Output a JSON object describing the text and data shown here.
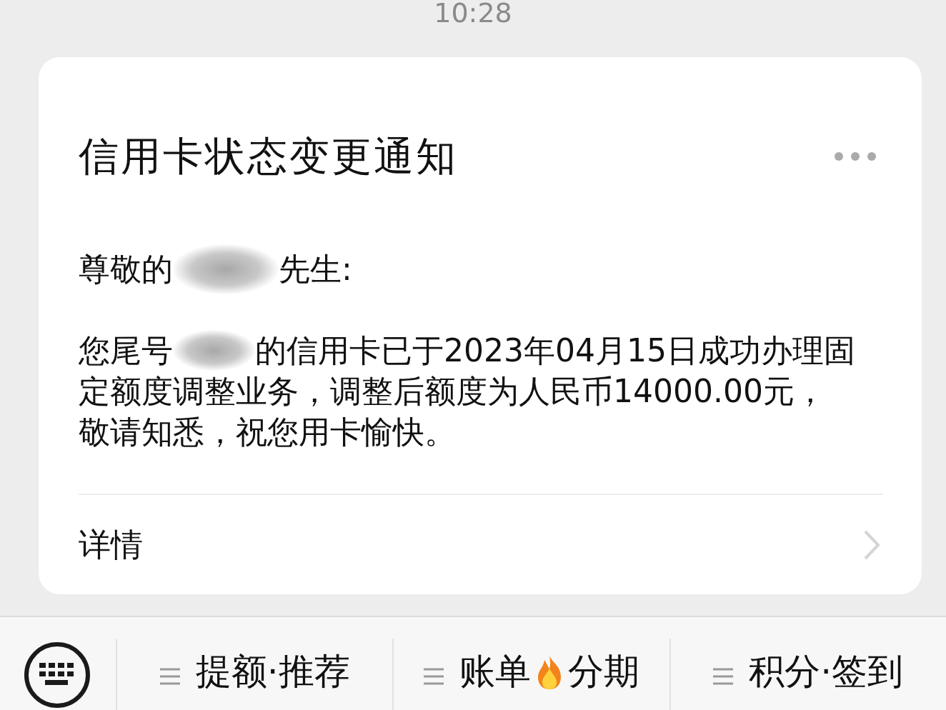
{
  "status_bar": {
    "time": "10:28"
  },
  "card": {
    "title": "信用卡状态变更通知",
    "greeting": {
      "before": "尊敬的",
      "redacted": true,
      "after": "先生:"
    },
    "body_lines": [
      {
        "before": "您尾号",
        "redacted": true,
        "after": "的信用卡已于2023年04月15日成功办理固"
      },
      {
        "before": "定额度调整业务，调整后额度为人民币14000.00元，"
      },
      {
        "before": "敬请知悉，祝您用卡愉快。"
      }
    ],
    "details_link": "详情"
  },
  "bottom_menu": [
    {
      "kind": "plain",
      "parts": [
        "提额·推荐"
      ]
    },
    {
      "kind": "flame",
      "parts": [
        "账单",
        "分期"
      ]
    },
    {
      "kind": "plain",
      "parts": [
        "积分·签到"
      ]
    }
  ]
}
